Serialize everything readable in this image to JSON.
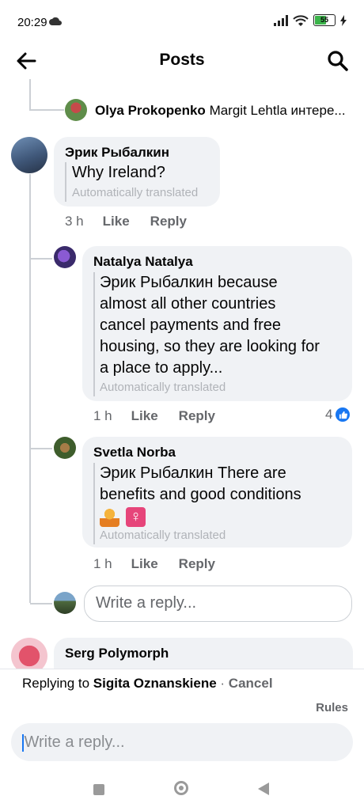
{
  "status": {
    "time": "20:29",
    "battery": "55"
  },
  "header": {
    "title": "Posts"
  },
  "thread": {
    "prev_reply": {
      "name": "Olya Prokopenko",
      "preview": "Margit Lehtla интере..."
    },
    "comment": {
      "name": "Эрик Рыбалкин",
      "text": "Why Ireland?",
      "translated": "Automatically translated",
      "time": "3 h",
      "like": "Like",
      "reply": "Reply"
    },
    "replies": [
      {
        "name": "Natalya Natalya",
        "lines": [
          "Эрик Рыбалкин because",
          "almost all other countries",
          "cancel payments and free",
          "housing, so they are looking for",
          "a place to apply..."
        ],
        "translated": "Automatically translated",
        "time": "1 h",
        "like": "Like",
        "reply": "Reply",
        "reactions": "4"
      },
      {
        "name": "Svetla Norba",
        "lines": [
          "Эрик Рыбалкин There are",
          "benefits and good conditions"
        ],
        "translated": "Automatically translated",
        "time": "1 h",
        "like": "Like",
        "reply": "Reply"
      }
    ],
    "reply_placeholder": "Write a reply...",
    "next_comment": {
      "name": "Serg Polymorph"
    }
  },
  "reply_bar": {
    "prefix": "Replying to",
    "target": "Sigita Oznanskiene",
    "separator": " · ",
    "cancel": "Cancel",
    "rules": "Rules",
    "placeholder": "Write a reply..."
  },
  "colors": {
    "accent": "#1877f2",
    "bubble": "#f0f2f5",
    "muted": "#65676b"
  }
}
